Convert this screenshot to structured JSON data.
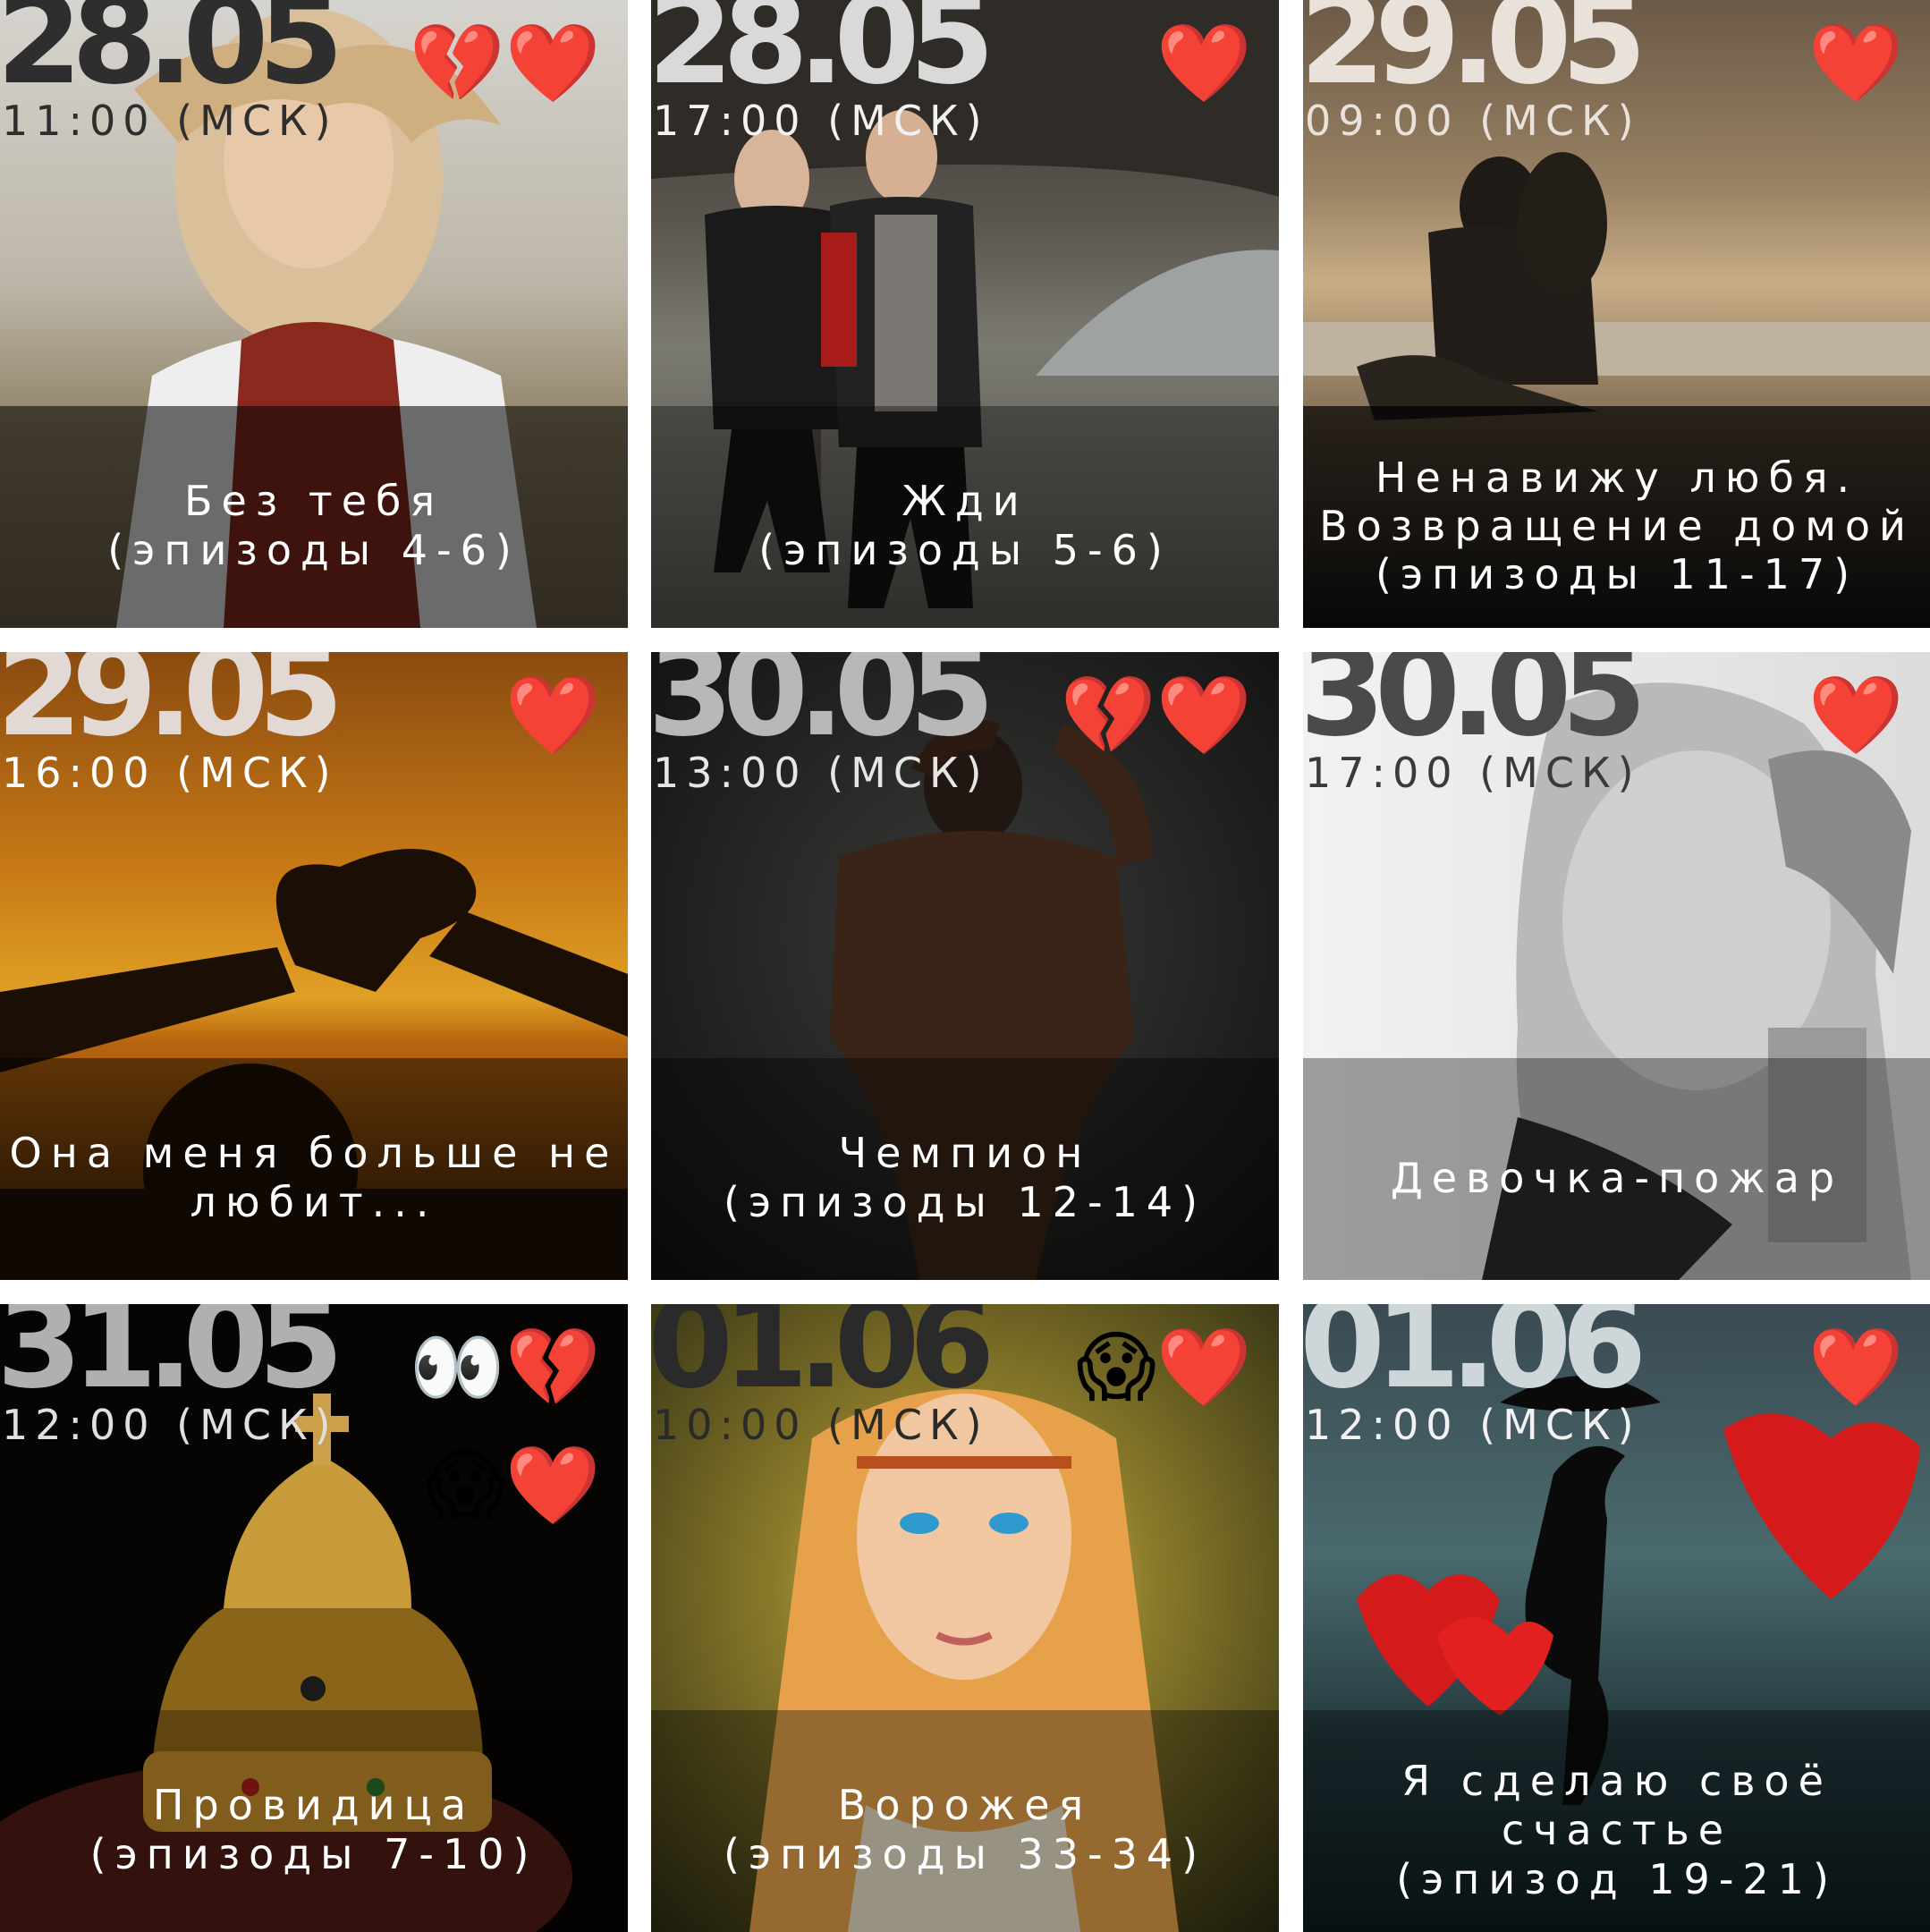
{
  "tiles": [
    {
      "date": "28.05",
      "time": "11:00 (МСК)",
      "emojis": "💔❤️",
      "emojis2": "",
      "title": "Без тебя",
      "subtitle": "(эпизоды 4-6)",
      "date_color": "#2e2e2e",
      "time_color": "#2e2e2e"
    },
    {
      "date": "28.05",
      "time": "17:00 (МСК)",
      "emojis": "❤️",
      "emojis2": "",
      "title": "Жди",
      "subtitle": "(эпизоды 5-6)",
      "date_color": "#d9d9d9",
      "time_color": "#f2f2f2"
    },
    {
      "date": "29.05",
      "time": "09:00 (МСК)",
      "emojis": "❤️",
      "emojis2": "",
      "title": "Ненавижу любя.\nВозвращение домой",
      "subtitle": "(эпизоды 11-17)",
      "date_color": "#e8e2da",
      "time_color": "#e8e2da"
    },
    {
      "date": "29.05",
      "time": "16:00 (МСК)",
      "emojis": "❤️",
      "emojis2": "",
      "title": "Она меня больше не\nлюбит...",
      "subtitle": "",
      "date_color": "#e2d8d4",
      "time_color": "#ffffff"
    },
    {
      "date": "30.05",
      "time": "13:00 (МСК)",
      "emojis": "💔❤️",
      "emojis2": "",
      "title": "Чемпион",
      "subtitle": "(эпизоды 12-14)",
      "date_color": "#b8b8b8",
      "time_color": "#e6e6e6"
    },
    {
      "date": "30.05",
      "time": "17:00 (МСК)",
      "emojis": "❤️",
      "emojis2": "",
      "title": "Девочка-пожар",
      "subtitle": "",
      "date_color": "#4a4a4a",
      "time_color": "#3a3a3a"
    },
    {
      "date": "31.05",
      "time": "12:00 (МСК)",
      "emojis": "👀💔",
      "emojis2": "😱❤️",
      "title": "Провидица",
      "subtitle": "(эпизоды 7-10)",
      "date_color": "#b0b0b0",
      "time_color": "#e0e0e0"
    },
    {
      "date": "01.06",
      "time": "10:00 (МСК)",
      "emojis": "😱❤️",
      "emojis2": "",
      "title": "Ворожея",
      "subtitle": "(эпизоды 33-34)",
      "date_color": "#2a2a2a",
      "time_color": "#2a2a2a"
    },
    {
      "date": "01.06",
      "time": "12:00 (МСК)",
      "emojis": "❤️",
      "emojis2": "",
      "title": "Я сделаю своё\nсчастье",
      "subtitle": "(эпизод 19-21)",
      "date_color": "#cfd6da",
      "time_color": "#f2f2f2"
    }
  ]
}
